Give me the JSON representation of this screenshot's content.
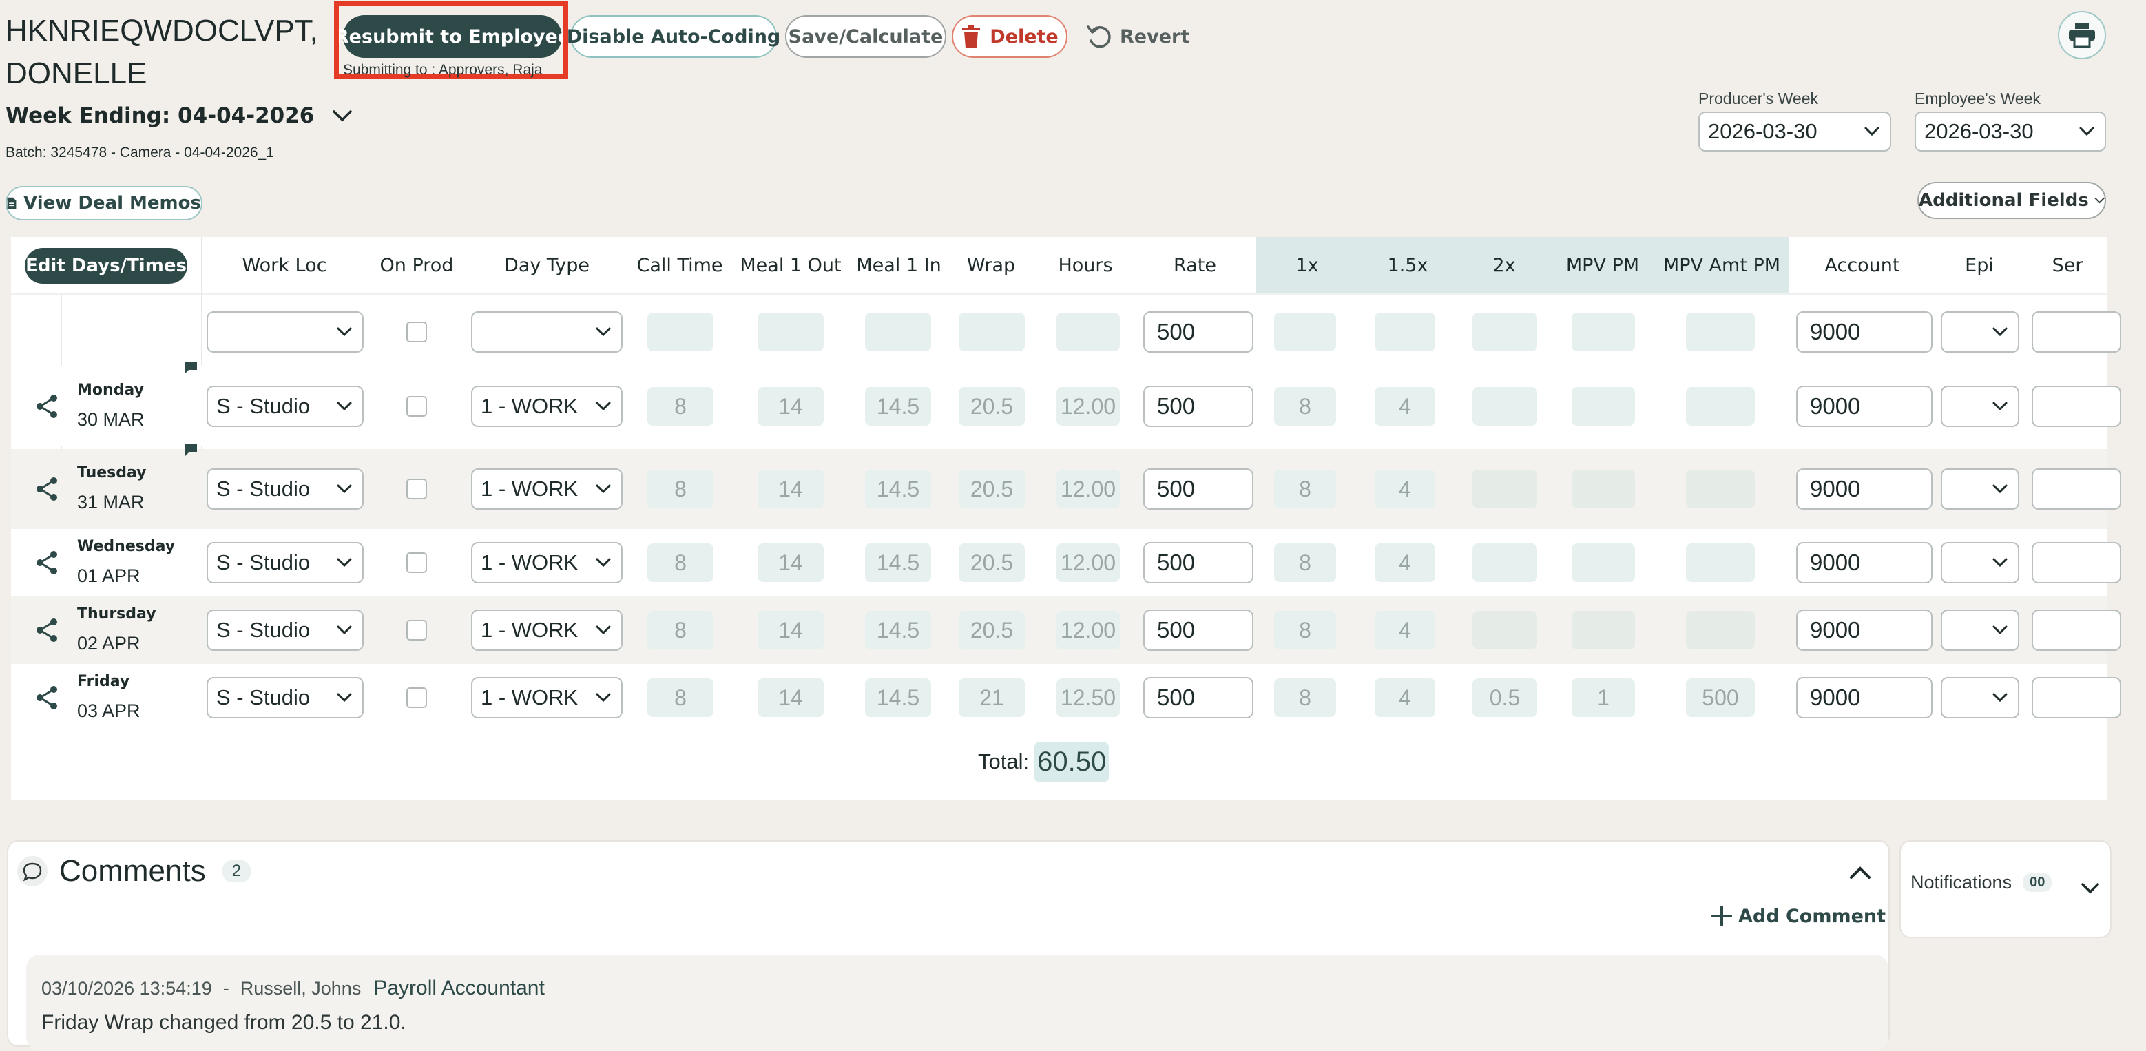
{
  "employee": {
    "name_line1": "HKNRIEQWDOCLVPT,",
    "name_line2": "DONELLE",
    "week_ending": "Week Ending: 04-04-2026",
    "batch": "Batch: 3245478 - Camera - 04-04-2026_1"
  },
  "toolbar": {
    "resubmit_label": "Resubmit to Employee",
    "submitting_to": "Submitting to : Approvers, Raja",
    "disable_autocoding_label": "Disable Auto-Coding",
    "save_label": "Save/Calculate",
    "delete_label": "Delete",
    "revert_label": "Revert"
  },
  "weeks": {
    "producer_label": "Producer's Week",
    "producer_value": "2026-03-30",
    "employee_label": "Employee's Week",
    "employee_value": "2026-03-30"
  },
  "view_deal_memos_label": "View Deal Memos",
  "additional_fields_label": "Additional Fields",
  "grid": {
    "edit_button_label": "Edit Days/Times",
    "columns": {
      "work_loc": "Work Loc",
      "on_prod": "On Prod",
      "day_type": "Day Type",
      "call_time": "Call Time",
      "meal1_out": "Meal 1 Out",
      "meal1_in": "Meal 1 In",
      "wrap": "Wrap",
      "hours": "Hours",
      "rate": "Rate",
      "x1": "1x",
      "x15": "1.5x",
      "x2": "2x",
      "mpv_pm": "MPV PM",
      "mpv_amt_pm": "MPV Amt PM",
      "account": "Account",
      "epi": "Epi",
      "ser": "Ser"
    },
    "template_row": {
      "rate": "500",
      "account": "9000"
    },
    "rows": [
      {
        "day": "Monday",
        "date": "30 MAR",
        "work_loc": "S - Studio",
        "day_type": "1 - WORK",
        "call": "8",
        "meal_out": "14",
        "meal_in": "14.5",
        "wrap": "20.5",
        "hours": "12.00",
        "rate": "500",
        "x1": "8",
        "x15": "4",
        "x2": "",
        "mpv": "",
        "mpv_amt": "",
        "account": "9000"
      },
      {
        "day": "Tuesday",
        "date": "31 MAR",
        "work_loc": "S - Studio",
        "day_type": "1 - WORK",
        "call": "8",
        "meal_out": "14",
        "meal_in": "14.5",
        "wrap": "20.5",
        "hours": "12.00",
        "rate": "500",
        "x1": "8",
        "x15": "4",
        "x2": "",
        "mpv": "",
        "mpv_amt": "",
        "account": "9000"
      },
      {
        "day": "Wednesday",
        "date": "01 APR",
        "work_loc": "S - Studio",
        "day_type": "1 - WORK",
        "call": "8",
        "meal_out": "14",
        "meal_in": "14.5",
        "wrap": "20.5",
        "hours": "12.00",
        "rate": "500",
        "x1": "8",
        "x15": "4",
        "x2": "",
        "mpv": "",
        "mpv_amt": "",
        "account": "9000"
      },
      {
        "day": "Thursday",
        "date": "02 APR",
        "work_loc": "S - Studio",
        "day_type": "1 - WORK",
        "call": "8",
        "meal_out": "14",
        "meal_in": "14.5",
        "wrap": "20.5",
        "hours": "12.00",
        "rate": "500",
        "x1": "8",
        "x15": "4",
        "x2": "",
        "mpv": "",
        "mpv_amt": "",
        "account": "9000"
      },
      {
        "day": "Friday",
        "date": "03 APR",
        "work_loc": "S - Studio",
        "day_type": "1 - WORK",
        "call": "8",
        "meal_out": "14",
        "meal_in": "14.5",
        "wrap": "21",
        "hours": "12.50",
        "rate": "500",
        "x1": "8",
        "x15": "4",
        "x2": "0.5",
        "mpv": "1",
        "mpv_amt": "500",
        "account": "9000"
      }
    ],
    "total_label": "Total:",
    "total_value": "60.50"
  },
  "comments": {
    "title": "Comments",
    "count": "2",
    "add_label": "Add Comment",
    "items": [
      {
        "timestamp": "03/10/2026 13:54:19",
        "separator": "-",
        "author": "Russell, Johns",
        "role": "Payroll Accountant",
        "text": "Friday Wrap changed from 20.5 to 21.0."
      }
    ]
  },
  "notifications": {
    "title": "Notifications",
    "count": "00"
  },
  "colors": {
    "primary": "#2e4a48",
    "delete": "#c0392b",
    "highlight_border": "#e53a25",
    "teal_light": "#e6f0ef",
    "overtime_header": "#dbe9e8"
  },
  "icons": [
    "print-icon",
    "trash-icon",
    "revert-icon",
    "chevron-down-icon",
    "document-icon",
    "share-icon",
    "comment-icon",
    "message-icon",
    "plus-icon",
    "chevron-up-icon"
  ]
}
